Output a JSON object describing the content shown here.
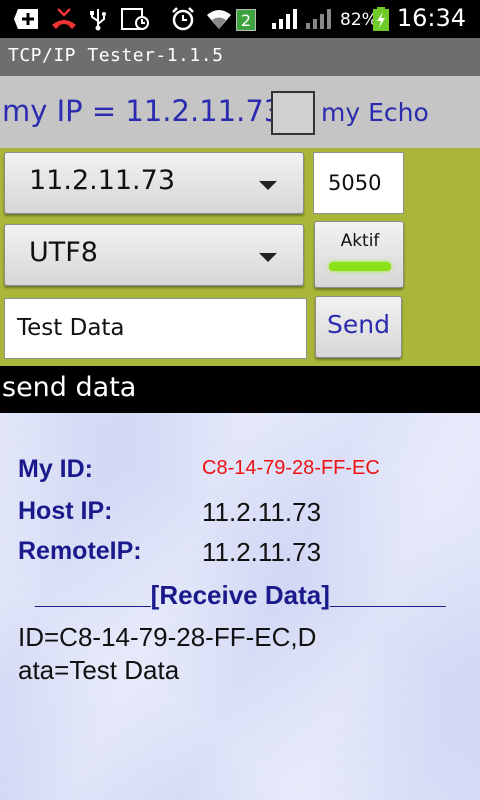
{
  "status_bar": {
    "badge": "2",
    "battery": "82%",
    "clock": "16:34",
    "icons": [
      "add-icon",
      "missed-call-icon",
      "usb-icon",
      "screenshot-icon",
      "alarm-icon",
      "wifi-icon",
      "signal-icon",
      "battery-charging-icon"
    ]
  },
  "app": {
    "title": "TCP/IP Tester-1.1.5"
  },
  "ip_row": {
    "my_ip": "my IP = 11.2.11.73",
    "echo_label": "my Echo"
  },
  "controls": {
    "host_spinner": "11.2.11.73",
    "port": "5050",
    "encoding_spinner": "UTF8",
    "toggle_label": "Aktif",
    "data_input": "Test Data",
    "send_label": "Send"
  },
  "send_strip": "send data",
  "receive": {
    "my_id_label": "My ID:",
    "my_id_value": "C8-14-79-28-FF-EC",
    "host_ip_label": "Host IP:",
    "host_ip_value": "11.2.11.73",
    "remote_ip_label": "RemoteIP:",
    "remote_ip_value": "11.2.11.73",
    "header": "________[Receive Data]________",
    "body": "ID=C8-14-79-28-FF-EC,Data=Test Data"
  },
  "colors": {
    "accent_blue": "#2b2bb0",
    "panel_green": "#a9b63a",
    "id_red": "#ee1111",
    "toggle_light": "#8ce21a"
  }
}
